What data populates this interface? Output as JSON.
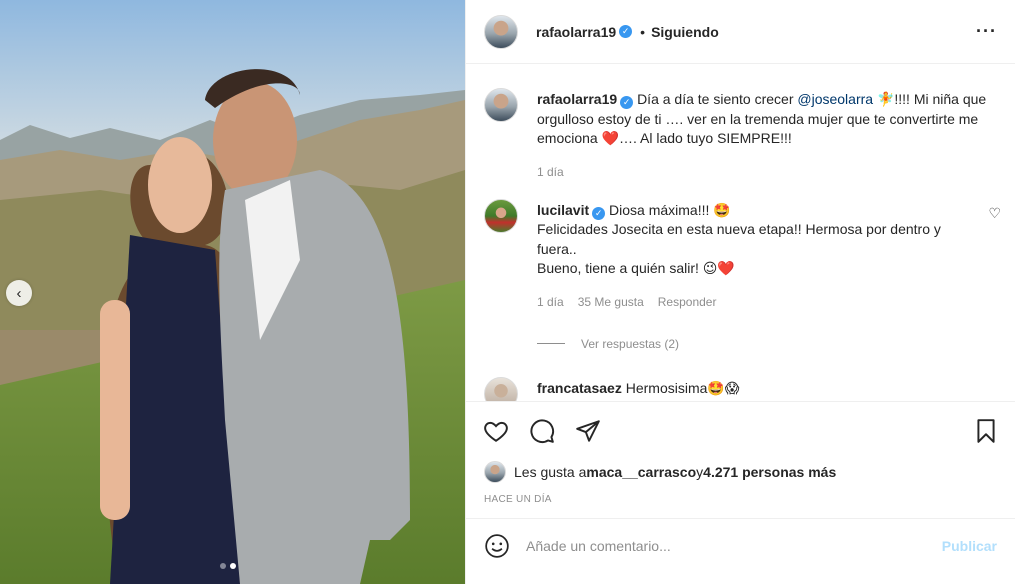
{
  "post": {
    "username": "rafaolarra19",
    "follow_status": "Siguiendo",
    "more_icon": "more-options-icon"
  },
  "photo": {
    "prev_icon": "chevron-left-icon",
    "slide_count": 2,
    "active_slide": 2
  },
  "caption": {
    "username": "rafaolarra19",
    "text_before": "Día a día te siento crecer ",
    "mention": "@joseolarra",
    "text_after": " 🧚!!!! Mi niña que orgulloso estoy de ti …. ver en la tremenda mujer que te convertirte me emociona ❤️…. Al lado tuyo SIEMPRE!!!",
    "time": "1 día"
  },
  "comments": [
    {
      "username": "lucilavit",
      "line1": " Diosa máxima!!! 🤩",
      "line2": "Felicidades Josecita en esta nueva etapa!! Hermosa por dentro y fuera..",
      "line3": "Bueno, tiene a quién salir! 😉❤️",
      "time": "1 día",
      "likes": "35 Me gusta",
      "reply": "Responder",
      "view_replies": "Ver respuestas (2)"
    },
    {
      "username": "francatasaez",
      "text": " Hermosisima🤩😱"
    }
  ],
  "actions": {
    "like_icon": "heart-icon",
    "comment_icon": "comment-icon",
    "share_icon": "share-icon",
    "save_icon": "bookmark-icon"
  },
  "likes": {
    "prefix": "Les gusta a ",
    "user": "maca__carrasco",
    "middle": " y ",
    "count": "4.271 personas más"
  },
  "timestamp": "Hace un día",
  "add_comment": {
    "placeholder": "Añade un comentario...",
    "publish_label": "Publicar",
    "emoji_icon": "smiley-icon"
  },
  "colors": {
    "verified": "#3897f0",
    "publish": "#b2dffc",
    "mention": "#00376b",
    "secondary_text": "#8e8e8e"
  }
}
